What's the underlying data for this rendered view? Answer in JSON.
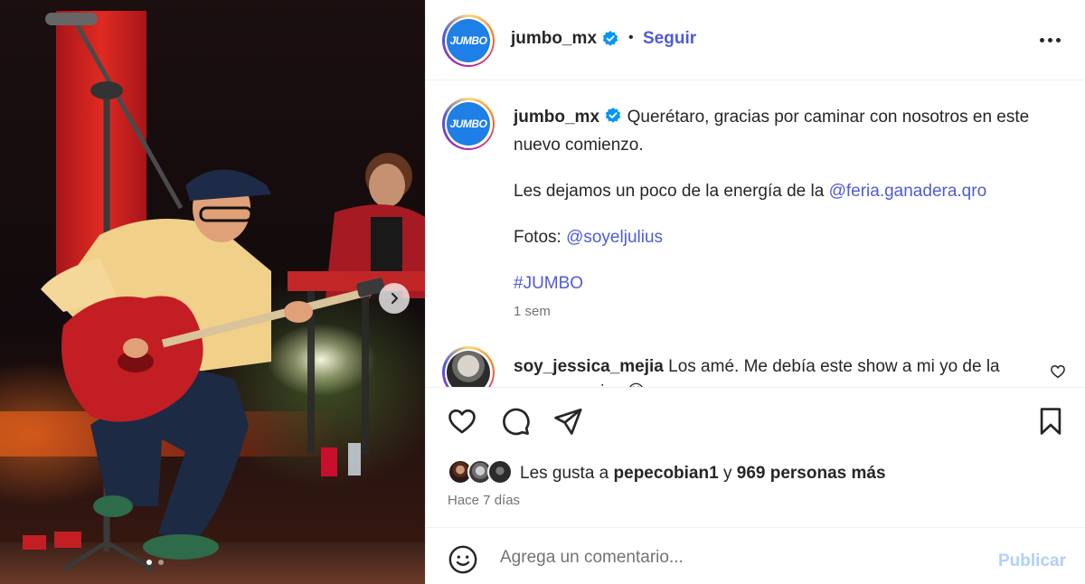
{
  "post": {
    "username": "jumbo_mx",
    "avatar_text": "JUMBO",
    "follow_label": "Seguir",
    "separator": "•",
    "caption": {
      "line1": "Querétaro, gracias por caminar con nosotros en este nuevo comienzo.",
      "line2_prefix": "Les dejamos un poco de la energía de la ",
      "line2_mention": "@feria.ganadera.qro",
      "line3_prefix": "Fotos: ",
      "line3_mention": "@soyeljulius",
      "hashtag": "#JUMBO",
      "time": "1 sem"
    },
    "comment": {
      "username": "soy_jessica_mejia",
      "text": "Los amé. Me debía este show a mi yo de la prepa, gracias 😊"
    },
    "likes": {
      "prefix": "Les gusta a ",
      "user": "pepecobian1",
      "middle": " y ",
      "count": "969 personas más"
    },
    "posted_ago": "Hace 7 días",
    "add_comment": {
      "placeholder": "Agrega un comentario...",
      "publish_label": "Publicar"
    }
  },
  "icons": {
    "verified": "verified-badge-icon",
    "more": "more-options-icon",
    "next": "chevron-right-icon",
    "like": "heart-icon",
    "comment": "comment-bubble-icon",
    "share": "paper-plane-icon",
    "save": "bookmark-icon",
    "emoji": "emoji-smile-icon"
  },
  "colors": {
    "link": "#4f5bd5",
    "verified": "#0095f6",
    "publish_disabled": "#b3cff8",
    "muted_text": "#737373"
  }
}
